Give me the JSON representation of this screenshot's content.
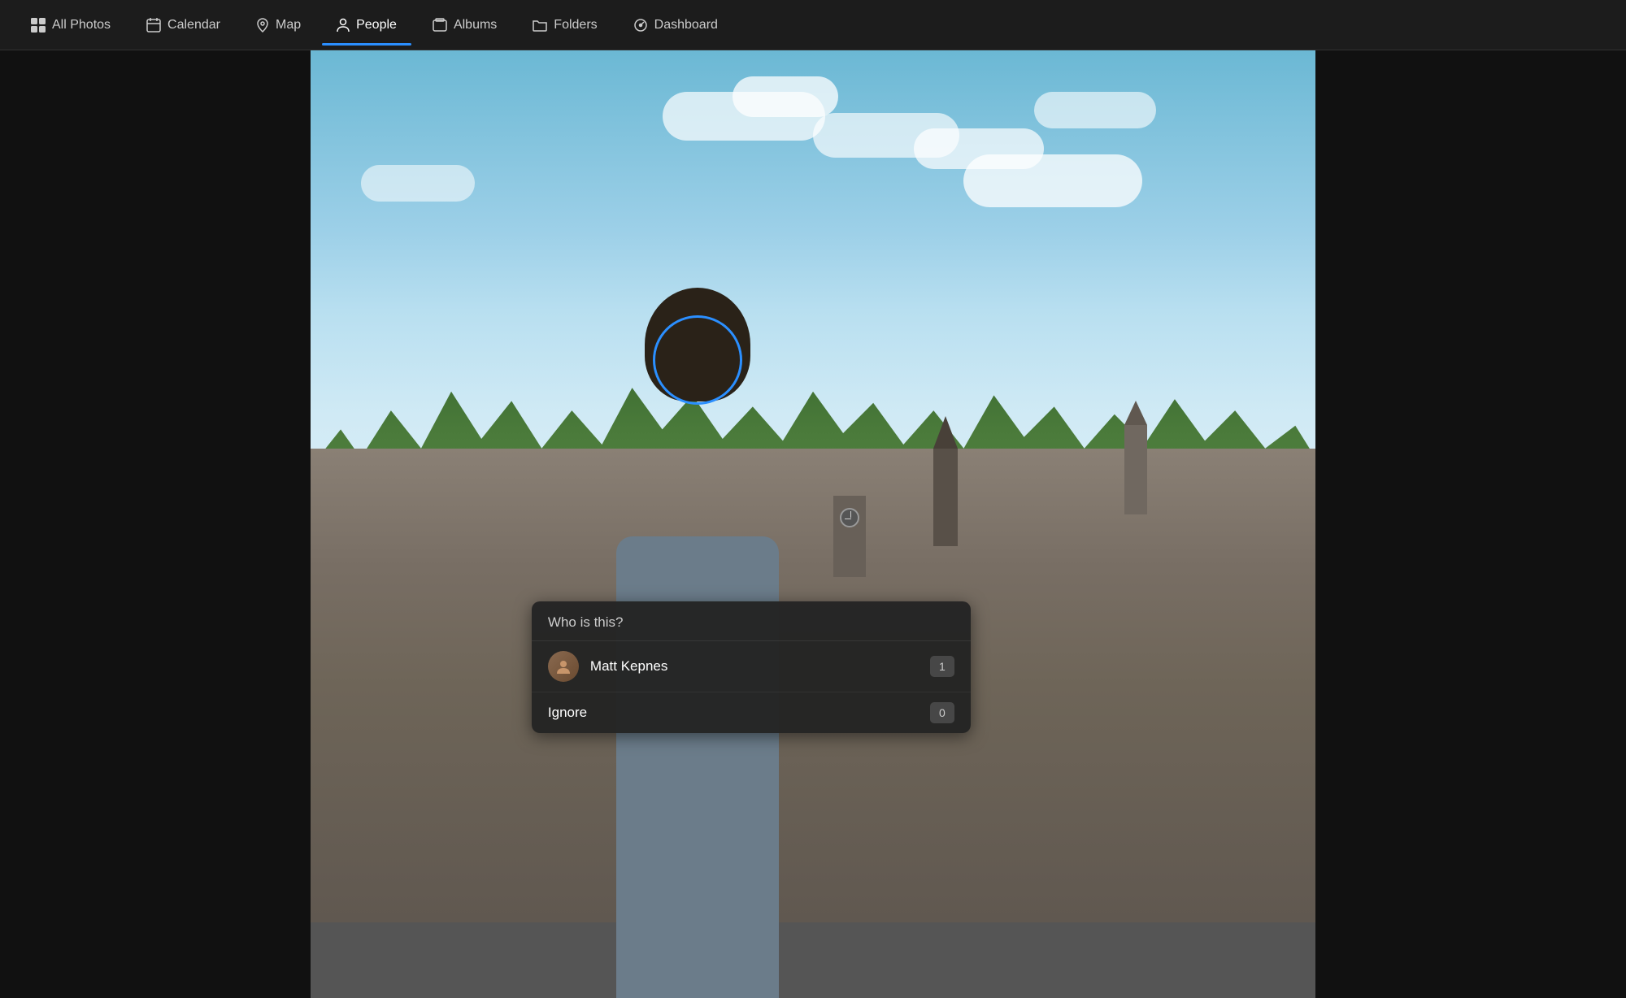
{
  "nav": {
    "items": [
      {
        "id": "all-photos",
        "label": "All Photos",
        "icon": "grid",
        "active": false
      },
      {
        "id": "calendar",
        "label": "Calendar",
        "icon": "calendar",
        "active": false
      },
      {
        "id": "map",
        "label": "Map",
        "icon": "map-pin",
        "active": false
      },
      {
        "id": "people",
        "label": "People",
        "icon": "person",
        "active": true
      },
      {
        "id": "albums",
        "label": "Albums",
        "icon": "album",
        "active": false
      },
      {
        "id": "folders",
        "label": "Folders",
        "icon": "folder",
        "active": false
      },
      {
        "id": "dashboard",
        "label": "Dashboard",
        "icon": "dashboard",
        "active": false
      }
    ]
  },
  "popup": {
    "title": "Who is this?",
    "options": [
      {
        "id": "matt-kepnes",
        "name": "Matt Kepnes",
        "count": "1",
        "has_avatar": true
      },
      {
        "id": "ignore",
        "name": "Ignore",
        "count": "0",
        "has_avatar": false
      }
    ]
  },
  "colors": {
    "accent": "#2b8fff",
    "nav_bg": "#1c1c1c",
    "popup_bg": "#232323",
    "active_underline": "#2b8fff"
  }
}
